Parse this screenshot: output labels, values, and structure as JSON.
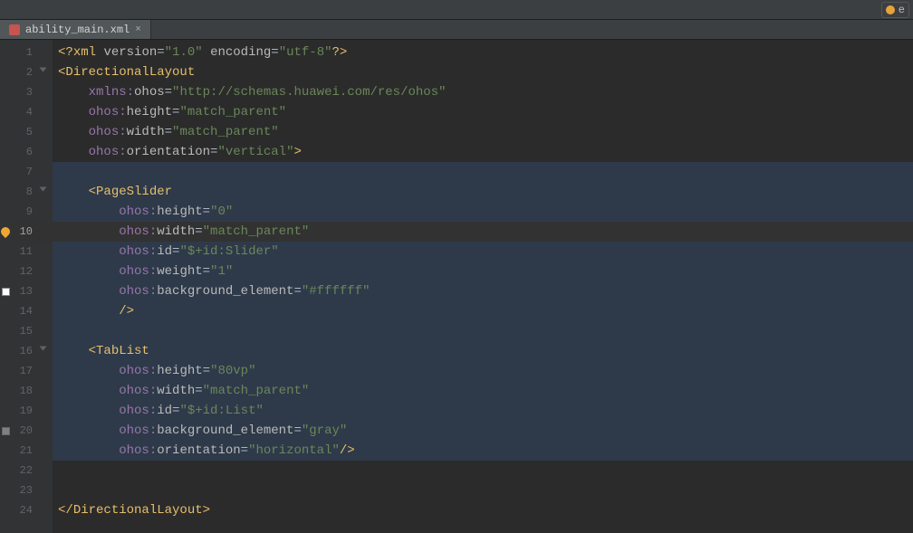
{
  "toolbar": {
    "right_label": "e"
  },
  "tab": {
    "filename": "ability_main.xml",
    "close": "×"
  },
  "gutter": {
    "lines": [
      "1",
      "2",
      "3",
      "4",
      "5",
      "6",
      "7",
      "8",
      "9",
      "10",
      "11",
      "12",
      "13",
      "14",
      "15",
      "16",
      "17",
      "18",
      "19",
      "20",
      "21",
      "22",
      "23",
      "24"
    ]
  },
  "code": {
    "l1": {
      "pi_open": "<?",
      "pi_name": "xml",
      "a1k": "version",
      "a1v": "\"1.0\"",
      "a2k": "encoding",
      "a2v": "\"utf-8\"",
      "pi_close": "?>"
    },
    "l2": {
      "open": "<",
      "tag": "DirectionalLayout"
    },
    "l3": {
      "ns": "xmlns:",
      "attr": "ohos",
      "val": "\"http://schemas.huawei.com/res/ohos\""
    },
    "l4": {
      "ns": "ohos:",
      "attr": "height",
      "val": "\"match_parent\""
    },
    "l5": {
      "ns": "ohos:",
      "attr": "width",
      "val": "\"match_parent\""
    },
    "l6": {
      "ns": "ohos:",
      "attr": "orientation",
      "val": "\"vertical\"",
      "close": ">"
    },
    "l8": {
      "open": "<",
      "tag": "PageSlider"
    },
    "l9": {
      "ns": "ohos:",
      "attr": "height",
      "val": "\"0\""
    },
    "l10": {
      "ns": "ohos:",
      "attr": "width",
      "val": "\"match_parent\""
    },
    "l11": {
      "ns": "ohos:",
      "attr": "id",
      "val": "\"$+id:Slider\""
    },
    "l12": {
      "ns": "ohos:",
      "attr": "weight",
      "val": "\"1\""
    },
    "l13": {
      "ns": "ohos:",
      "attr": "background_element",
      "val": "\"#ffffff\""
    },
    "l14": {
      "close": "/>"
    },
    "l16": {
      "open": "<",
      "tag": "TabList"
    },
    "l17": {
      "ns": "ohos:",
      "attr": "height",
      "val": "\"80vp\""
    },
    "l18": {
      "ns": "ohos:",
      "attr": "width",
      "val": "\"match_parent\""
    },
    "l19": {
      "ns": "ohos:",
      "attr": "id",
      "val": "\"$+id:List\""
    },
    "l20": {
      "ns": "ohos:",
      "attr": "background_element",
      "val": "\"gray\""
    },
    "l21": {
      "ns": "ohos:",
      "attr": "orientation",
      "val": "\"horizontal\"",
      "close": "/>"
    },
    "l24": {
      "open": "</",
      "tag": "DirectionalLayout",
      "close": ">"
    }
  }
}
